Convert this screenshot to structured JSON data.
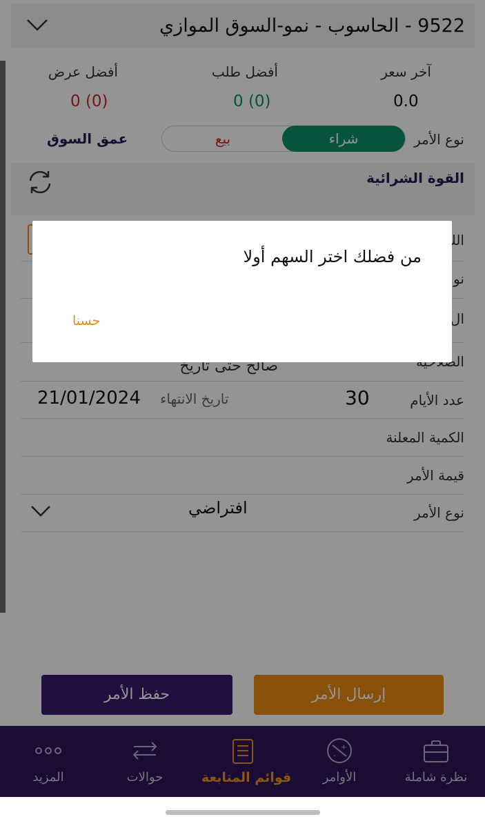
{
  "header": {
    "title": "9522 - الحاسوب - نمو-السوق الموازي"
  },
  "stats": {
    "last_price_label": "آخر سعر",
    "last_price_value": "0.0",
    "best_bid_label": "أفضل طلب",
    "best_bid_value": "0 (0)",
    "best_offer_label": "أفضل عرض",
    "best_offer_value": "0 (0)"
  },
  "order_side": {
    "label": "نوع الأمر",
    "buy": "شراء",
    "sell": "بيع",
    "market_depth": "عمق السوق"
  },
  "buying_power": {
    "label": "القوة الشرائية"
  },
  "form": {
    "partial_labels": [
      "الك",
      "نو",
      "ال",
      "الصلاحية"
    ],
    "validity_value_partial": "صالح حتى تاريخ",
    "days_label": "عدد الأيام",
    "days_value": "30",
    "expiry_label": "تاريخ الانتهاء",
    "expiry_value": "21/01/2024",
    "disclosed_qty_label": "الكمية المعلنة",
    "order_value_label": "قيمة الأمر",
    "order_type_label": "نوع الأمر",
    "order_type_value": "افتراضي"
  },
  "buttons": {
    "send": "إرسال الأمر",
    "save": "حفظ الأمر"
  },
  "tabbar": {
    "overview": "نظرة شاملة",
    "orders": "الأوامر",
    "watchlists": "قوائم المتابعة",
    "transfers": "حوالات",
    "more": "المزيد"
  },
  "dialog": {
    "message": "من فضلك اختر السهم أولا",
    "ok": "حسنا"
  },
  "colors": {
    "primary": "#2d1558",
    "accent": "#e88a14",
    "buy": "#0f8f6a",
    "sell": "#cc2a2a"
  }
}
